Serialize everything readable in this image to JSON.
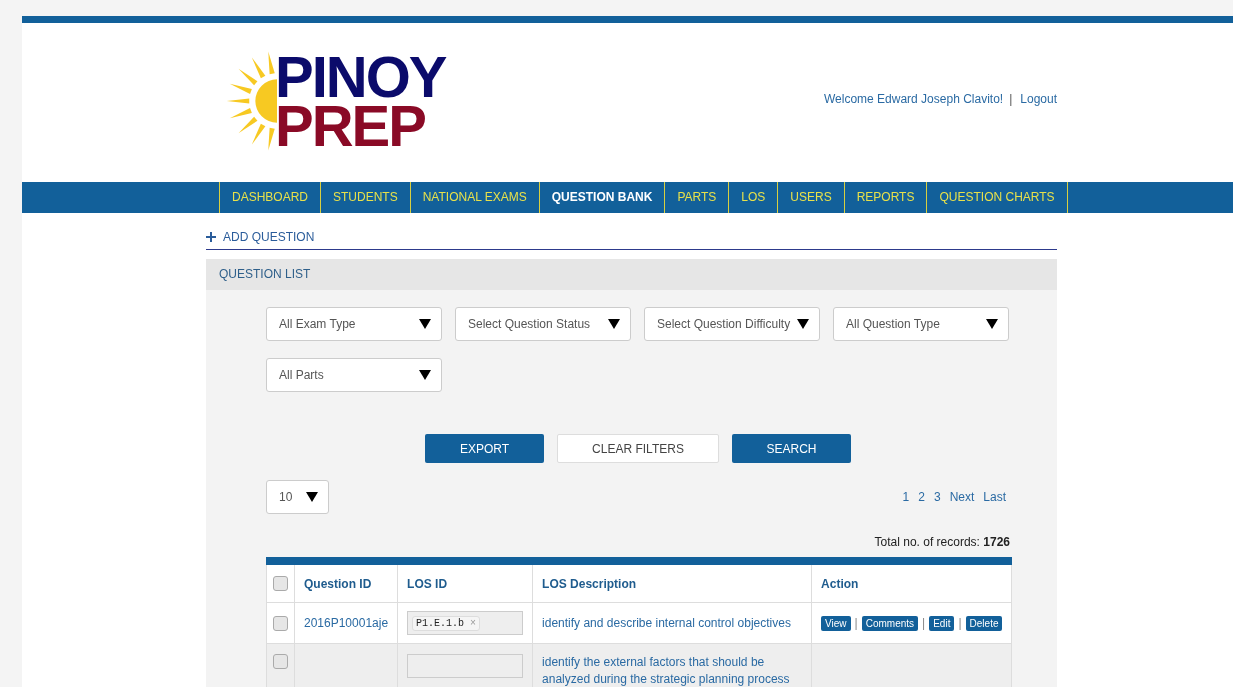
{
  "logo": {
    "line_1": "PINOY",
    "line_2": "PREP"
  },
  "header": {
    "welcome": "Welcome Edward Joseph Clavito!",
    "separator": "|",
    "logout": "Logout"
  },
  "nav": [
    {
      "label": "DASHBOARD",
      "selected": false
    },
    {
      "label": "STUDENTS",
      "selected": false
    },
    {
      "label": "NATIONAL EXAMS",
      "selected": false
    },
    {
      "label": "QUESTION BANK",
      "selected": true
    },
    {
      "label": "PARTS",
      "selected": false
    },
    {
      "label": "LOS",
      "selected": false
    },
    {
      "label": "USERS",
      "selected": false
    },
    {
      "label": "REPORTS",
      "selected": false
    },
    {
      "label": "QUESTION CHARTS",
      "selected": false
    }
  ],
  "add_question": "ADD QUESTION",
  "panel_title": "QUESTION LIST",
  "filters": [
    "All Exam Type",
    "Select Question Status",
    "Select Question Difficulty",
    "All Question Type",
    "All Parts"
  ],
  "buttons": [
    {
      "label": "EXPORT",
      "kind": "primary"
    },
    {
      "label": "CLEAR FILTERS",
      "kind": "secondary"
    },
    {
      "label": "SEARCH",
      "kind": "primary"
    }
  ],
  "page_size": "10",
  "pagination": [
    "1",
    "2",
    "3",
    "Next",
    "Last"
  ],
  "total": {
    "label": "Total no. of records:",
    "value": "1726"
  },
  "table": {
    "header_checked": false,
    "columns": [
      "Question ID",
      "LOS ID",
      "LOS Description",
      "Action"
    ],
    "actions": [
      "View",
      "Comments",
      "Edit",
      "Delete"
    ],
    "action_separator": "|",
    "rows": [
      {
        "checked": false,
        "id": "2016P10001aje",
        "los": "P1.E.1.b",
        "remove": "×",
        "description": "identify and describe internal control objectives",
        "show_actions": true
      },
      {
        "checked": false,
        "description": "identify the external factors that should be analyzed during the strategic planning process",
        "show_actions": false
      }
    ]
  }
}
